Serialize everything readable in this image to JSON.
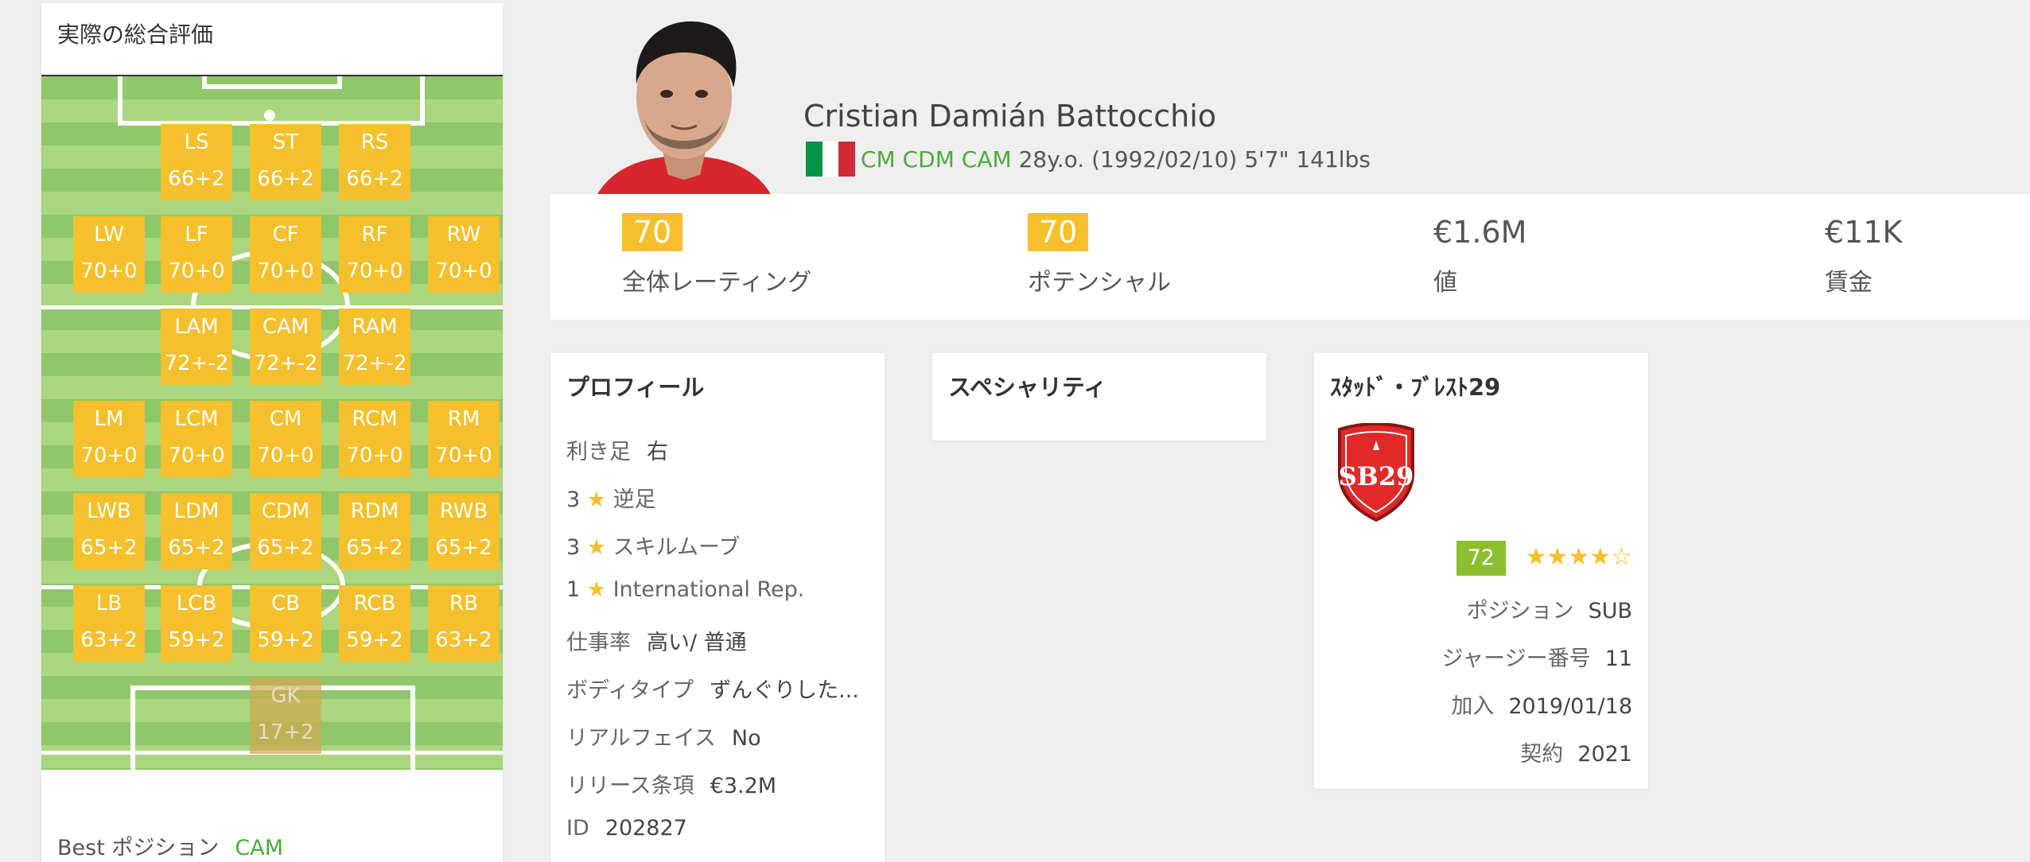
{
  "left_panel": {
    "title": "実際の総合評価",
    "positions": [
      {
        "code": "LS",
        "rating": "66+2"
      },
      {
        "code": "ST",
        "rating": "66+2"
      },
      {
        "code": "RS",
        "rating": "66+2"
      },
      {
        "code": "LW",
        "rating": "70+0"
      },
      {
        "code": "LF",
        "rating": "70+0"
      },
      {
        "code": "CF",
        "rating": "70+0"
      },
      {
        "code": "RF",
        "rating": "70+0"
      },
      {
        "code": "RW",
        "rating": "70+0"
      },
      {
        "code": "LAM",
        "rating": "72+-2"
      },
      {
        "code": "CAM",
        "rating": "72+-2"
      },
      {
        "code": "RAM",
        "rating": "72+-2"
      },
      {
        "code": "LM",
        "rating": "70+0"
      },
      {
        "code": "LCM",
        "rating": "70+0"
      },
      {
        "code": "CM",
        "rating": "70+0"
      },
      {
        "code": "RCM",
        "rating": "70+0"
      },
      {
        "code": "RM",
        "rating": "70+0"
      },
      {
        "code": "LWB",
        "rating": "65+2"
      },
      {
        "code": "LDM",
        "rating": "65+2"
      },
      {
        "code": "CDM",
        "rating": "65+2"
      },
      {
        "code": "RDM",
        "rating": "65+2"
      },
      {
        "code": "RWB",
        "rating": "65+2"
      },
      {
        "code": "LB",
        "rating": "63+2"
      },
      {
        "code": "LCB",
        "rating": "59+2"
      },
      {
        "code": "CB",
        "rating": "59+2"
      },
      {
        "code": "RCB",
        "rating": "59+2"
      },
      {
        "code": "RB",
        "rating": "63+2"
      },
      {
        "code": "GK",
        "rating": "17+2"
      }
    ],
    "best_label": "Best ポジション",
    "best_value": "CAM"
  },
  "player": {
    "name": "Cristian Damián Battocchio",
    "positions": "CM CDM CAM",
    "info": "28y.o. (1992/02/10) 5'7\" 141lbs",
    "flag_colors": [
      "#009246",
      "#ffffff",
      "#ce2b37"
    ]
  },
  "stats": [
    {
      "value": "70",
      "label": "全体レーティング",
      "highlight": true
    },
    {
      "value": "70",
      "label": "ポテンシャル",
      "highlight": true
    },
    {
      "value": "€1.6M",
      "label": "値",
      "highlight": false
    },
    {
      "value": "€11K",
      "label": "賃金",
      "highlight": false
    }
  ],
  "profile": {
    "title": "プロフィール",
    "rows": [
      {
        "key": "利き足",
        "value": "右"
      },
      {
        "num": "3",
        "key": "逆足"
      },
      {
        "num": "3",
        "key": "スキルムーブ"
      },
      {
        "num": "1",
        "key": "International Rep."
      },
      {
        "key": "仕事率",
        "value": "高い/ 普通"
      },
      {
        "key": "ボディタイプ",
        "value": "ずんぐりした..."
      },
      {
        "key": "リアルフェイス",
        "value": "No"
      },
      {
        "key": "リリース条項",
        "value": "€3.2M"
      },
      {
        "key": "ID",
        "value": "202827"
      }
    ]
  },
  "specialty": {
    "title": "スペシャリティ"
  },
  "club": {
    "title": "ｽﾀｯﾄﾞ・ﾌﾞﾚｽﾄ29",
    "crest_text": "SB29",
    "rating": "72",
    "stars": "★★★★☆",
    "position_label": "ポジション",
    "position_value": "SUB",
    "jersey_label": "ジャージー番号",
    "jersey_value": "11",
    "joined_label": "加入",
    "joined_value": "2019/01/18",
    "contract_label": "契約",
    "contract_value": "2021"
  },
  "colors": {
    "accent": "#f5c02b",
    "green": "#4cab3c",
    "club_badge": "#8bbf2f"
  }
}
